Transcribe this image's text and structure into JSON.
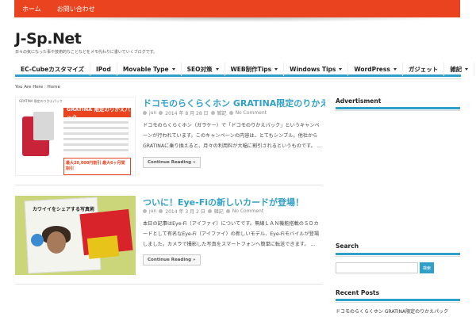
{
  "topbar": {
    "items": [
      "ホーム",
      "お問い合わせ"
    ]
  },
  "site": {
    "title": "J-Sp.Net",
    "description": "日々の気になった事や技術的なことなどをメモ代わりに書いていくブログです。"
  },
  "nav": {
    "items": [
      {
        "label": "EC-Cubeカスタマイズ",
        "dropdown": false
      },
      {
        "label": "IPod",
        "dropdown": false
      },
      {
        "label": "Movable Type",
        "dropdown": true
      },
      {
        "label": "SEO対策",
        "dropdown": true
      },
      {
        "label": "WEB制作Tips",
        "dropdown": true
      },
      {
        "label": "Windows Tips",
        "dropdown": true
      },
      {
        "label": "WordPress",
        "dropdown": true
      },
      {
        "label": "ガジェット",
        "dropdown": false
      },
      {
        "label": "雑記",
        "dropdown": true
      }
    ]
  },
  "breadcrumb": "You Are Here : Home",
  "posts": [
    {
      "title": "ドコモのらくらくホン GRATINA限定のりかえパック",
      "author": "jun",
      "date": "2014 年 8 月 28 日",
      "category": "雑記",
      "comments": "No Comment",
      "excerpt": "ドコモのらくらくホン（ガラケー）で「ドコモのりかえパック」というキャンペーンが行われています。このキャンペーンの内容は、とてもシンプル。他社からGRATINAに乗り換えると、月々の利用料が大幅に割引されるというものです。 …",
      "readmore": "Continue Reading »",
      "thumb_text": {
        "header": "GRATINA 限定のりかえパック",
        "banner": "GRATINA 限定のりかえパック",
        "offer": "最大20,000円割引 最大6ヶ月間割引"
      }
    },
    {
      "title": "ついに！Eye-Fiの新しいカードが登場！",
      "author": "jun",
      "date": "2014 年 3 月 2 日",
      "category": "雑記",
      "comments": "No Comment",
      "excerpt": "本日の記事はEye-Fi（アイファイ）についてです。無線ＬＡＮ機能搭載のＳＤカードとして有名なEye-Fi（アイファイ）の新しいモデル、Eye-Fiモバイルが登場しました。カメラで撮影した写真をスマートフォンへ簡単に転送できます。 …",
      "readmore": "Continue Reading »",
      "thumb_text": {
        "book_title": "カワイイをシェアする写真術"
      }
    }
  ],
  "sidebar": {
    "advertisement": "Advertisment",
    "search": {
      "title": "Search",
      "placeholder": "",
      "button": "検索"
    },
    "recent": {
      "title": "Recent Posts",
      "items": [
        "ドコモのらくらくホン GRATINA限定のりかえパック"
      ]
    }
  },
  "colors": {
    "accent": "#30a0c8",
    "topbar": "#e9431f"
  }
}
